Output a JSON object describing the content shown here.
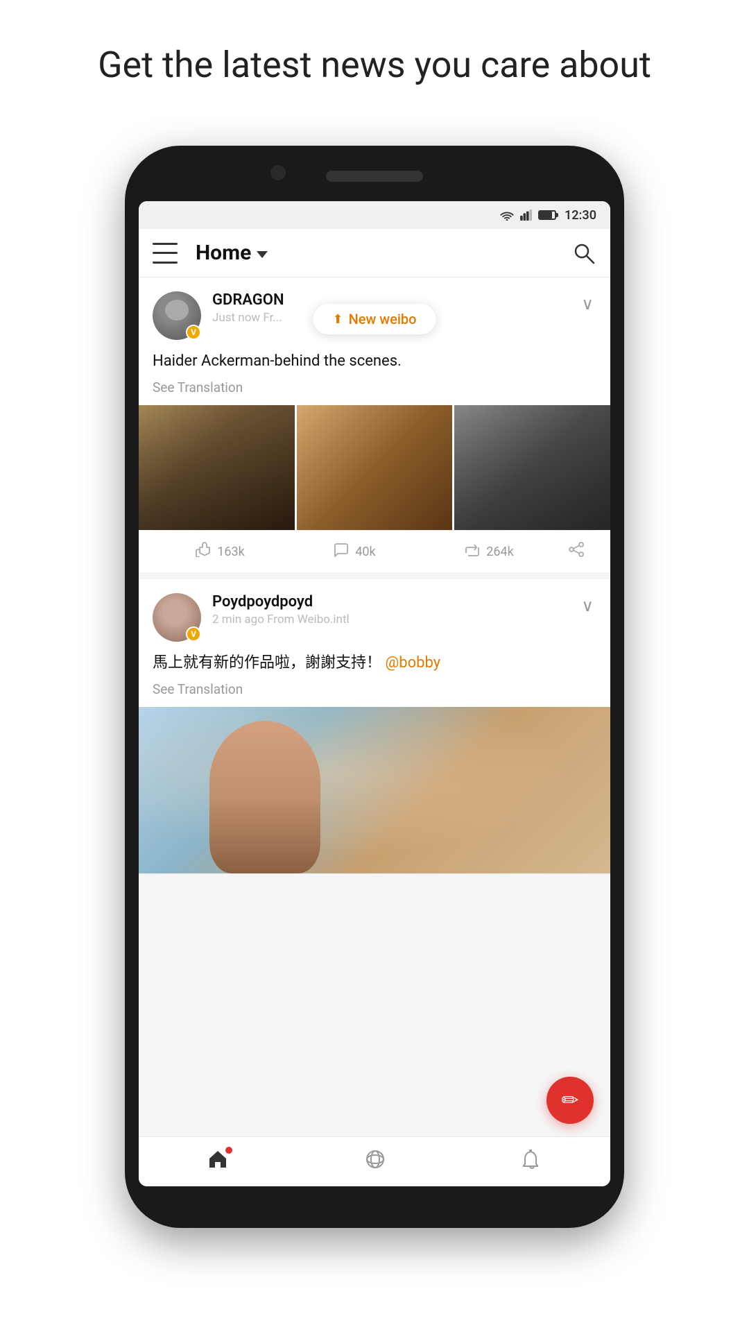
{
  "page": {
    "headline": "Get the latest news you care about"
  },
  "status_bar": {
    "time": "12:30"
  },
  "header": {
    "title": "Home",
    "menu_label": "Menu",
    "search_label": "Search"
  },
  "new_weibo": {
    "label": "New weibo"
  },
  "posts": [
    {
      "id": "post1",
      "username": "GDRAGON",
      "time": "Just now",
      "source": "Fr...",
      "content": "Haider Ackerman-behind the scenes.",
      "see_translation": "See Translation",
      "likes": "163k",
      "comments": "40k",
      "reposts": "264k",
      "has_images": true
    },
    {
      "id": "post2",
      "username": "Poydpoydpoyd",
      "time": "2 min ago",
      "source": "From Weibo.intl",
      "content": "馬上就有新的作品啦，謝謝支持！",
      "mention": "@bobby",
      "see_translation": "See Translation",
      "has_image": true
    }
  ],
  "bottom_nav": {
    "home_label": "Home",
    "discover_label": "Discover",
    "notifications_label": "Notifications"
  },
  "fab": {
    "label": "Compose"
  }
}
